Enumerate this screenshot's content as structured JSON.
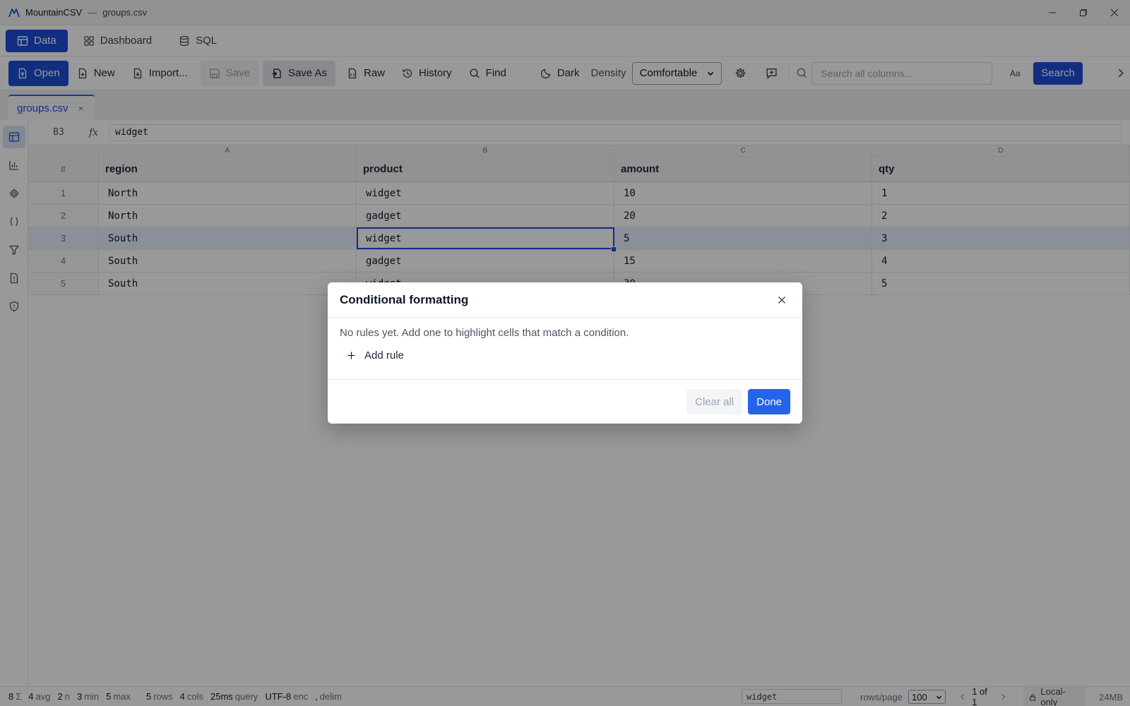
{
  "titlebar": {
    "app_name": "MountainCSV",
    "separator": "—",
    "file_name": "groups.csv"
  },
  "view_tabs": [
    {
      "label": "Data",
      "icon": "table-icon",
      "active": true
    },
    {
      "label": "Dashboard",
      "icon": "dashboard-icon"
    },
    {
      "label": "SQL",
      "icon": "database-icon"
    }
  ],
  "toolbar": {
    "open": "Open",
    "new": "New",
    "import": "Import...",
    "save": "Save",
    "save_as": "Save As",
    "raw": "Raw",
    "history": "History",
    "find": "Find",
    "dark": "Dark",
    "density_label": "Density",
    "density_value": "Comfortable",
    "search_placeholder": "Search all columns...",
    "case_toggle": "Aa",
    "search_button": "Search"
  },
  "file_tabs": [
    {
      "label": "groups.csv",
      "close": "×",
      "active": true
    }
  ],
  "formula_bar": {
    "cell_ref": "B3",
    "fx": "fx",
    "value": "widget"
  },
  "grid": {
    "column_letters": [
      "A",
      "B",
      "C",
      "D"
    ],
    "row_number_header": "#",
    "headers": [
      "region",
      "product",
      "amount",
      "qty"
    ],
    "rows": [
      {
        "n": "1",
        "cells": [
          "North",
          "widget",
          "10",
          "1"
        ]
      },
      {
        "n": "2",
        "cells": [
          "North",
          "gadget",
          "20",
          "2"
        ]
      },
      {
        "n": "3",
        "cells": [
          "South",
          "widget",
          "5",
          "3"
        ]
      },
      {
        "n": "4",
        "cells": [
          "South",
          "gadget",
          "15",
          "4"
        ]
      },
      {
        "n": "5",
        "cells": [
          "South",
          "widget",
          "30",
          "5"
        ]
      }
    ],
    "selected_row": 3,
    "active_cell": "B3"
  },
  "status": {
    "sum_value": "8",
    "sum_symbol": "Σ",
    "avg_value": "4",
    "avg_label": "avg",
    "n_value": "2",
    "n_label": "n",
    "min_value": "3",
    "min_label": "min",
    "max_value": "5",
    "max_label": "max",
    "rows_value": "5",
    "rows_label": "rows",
    "cols_value": "4",
    "cols_label": "cols",
    "query_value": "25ms",
    "query_label": "query",
    "enc_value": "UTF-8",
    "enc_label": "enc",
    "delim_value": ",",
    "delim_label": "delim",
    "cell_value": "widget",
    "rows_per_page_label": "rows/page",
    "rows_per_page": "100",
    "page_info": "1 of 1",
    "local_only": "Local-only",
    "memory": "24MB"
  },
  "modal": {
    "title": "Conditional formatting",
    "empty_message": "No rules yet. Add one to highlight cells that match a condition.",
    "add_rule": "Add rule",
    "clear_all": "Clear all",
    "done": "Done"
  },
  "colors": {
    "accent": "#1d4ed8",
    "primary_button": "#2563eb",
    "selected_row": "#e8effd"
  }
}
